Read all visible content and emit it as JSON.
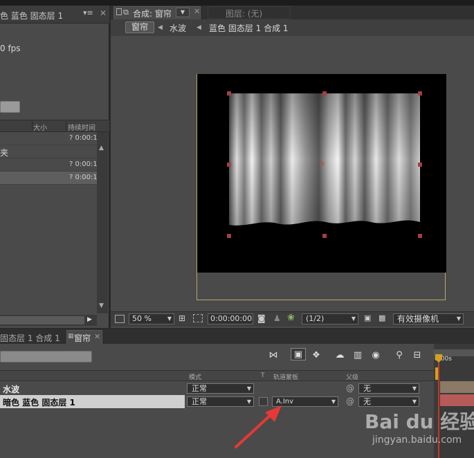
{
  "project_panel": {
    "tab_label": "色 蓝色 固态层 1",
    "menu_label": "▾≡",
    "fps_text": "0 fps",
    "columns": {
      "size": "大小",
      "duration": "持续时间"
    },
    "rows": [
      {
        "name": "",
        "duration": "? 0:00:1"
      },
      {
        "name": "夹",
        "duration": ""
      },
      {
        "name": "",
        "duration": "? 0:00:1"
      },
      {
        "name": "",
        "duration": "? 0:00:1"
      }
    ]
  },
  "comp_viewer": {
    "tab_label": "合成: 窗帘",
    "layer_tab_label": "图层: (无)",
    "breadcrumbs": [
      "窗帘",
      "水波",
      "蓝色 固态层 1 合成 1"
    ],
    "zoom": "50 %",
    "timecode": "0:00:00:00",
    "resolution": "(1/2)",
    "camera": "有效摄像机"
  },
  "timeline": {
    "tabs": [
      "固态层 1 合成 1",
      "窗帘"
    ],
    "ruler_label": "0:00s",
    "column_headers": {
      "mode": "模式",
      "t": "T",
      "track_matte": "轨道蒙板",
      "parent": "父级"
    },
    "layers": [
      {
        "name": "水波",
        "mode": "正常",
        "track_matte": "",
        "parent": "无"
      },
      {
        "name": "暗色 蓝色 固态层 1",
        "mode": "正常",
        "track_matte": "A.Inv",
        "parent": "无"
      }
    ]
  },
  "watermark": {
    "logo": "Bai du 经验",
    "sub": "jingyan.baidu.com"
  },
  "colors": {
    "panel": "#4a4a4a",
    "accent_red": "#e53935",
    "work_area": "#d4a020"
  }
}
